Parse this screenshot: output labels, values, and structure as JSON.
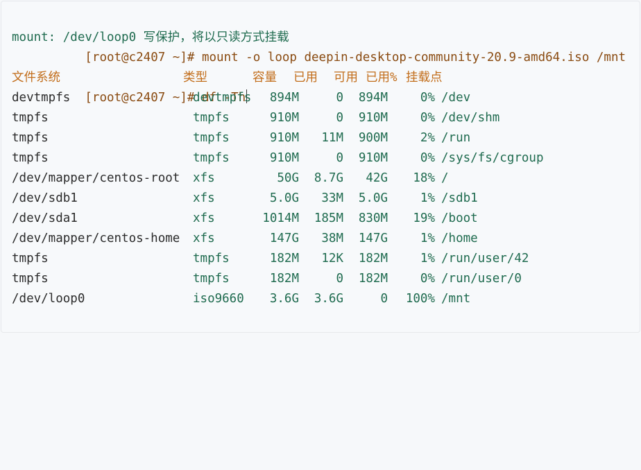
{
  "terminal": {
    "line1": {
      "prompt": "[root@c2407 ~]#",
      "command": " mount -o loop deepin-desktop-community-20.9-amd64.iso /mnt"
    },
    "line2": {
      "message": "mount: /dev/loop0 写保护，将以只读方式挂载"
    },
    "line3": {
      "prompt": "[root@c2407 ~]#",
      "command": " df -Th"
    },
    "header": {
      "filesystem": "文件系统",
      "type": "类型",
      "size": "容量",
      "used": "已用",
      "avail": "可用",
      "use_pct": "已用%",
      "mounted_on": "挂载点"
    },
    "rows": [
      {
        "filesystem": "devtmpfs",
        "type": "devtmpfs",
        "size": "894M",
        "used": "0",
        "avail": "894M",
        "use_pct": "0%",
        "mounted_on": "/dev"
      },
      {
        "filesystem": "tmpfs",
        "type": "tmpfs",
        "size": "910M",
        "used": "0",
        "avail": "910M",
        "use_pct": "0%",
        "mounted_on": "/dev/shm"
      },
      {
        "filesystem": "tmpfs",
        "type": "tmpfs",
        "size": "910M",
        "used": "11M",
        "avail": "900M",
        "use_pct": "2%",
        "mounted_on": "/run"
      },
      {
        "filesystem": "tmpfs",
        "type": "tmpfs",
        "size": "910M",
        "used": "0",
        "avail": "910M",
        "use_pct": "0%",
        "mounted_on": "/sys/fs/cgroup"
      },
      {
        "filesystem": "/dev/mapper/centos-root",
        "type": "xfs",
        "size": "50G",
        "used": "8.7G",
        "avail": "42G",
        "use_pct": "18%",
        "mounted_on": "/"
      },
      {
        "filesystem": "/dev/sdb1",
        "type": "xfs",
        "size": "5.0G",
        "used": "33M",
        "avail": "5.0G",
        "use_pct": "1%",
        "mounted_on": "/sdb1"
      },
      {
        "filesystem": "/dev/sda1",
        "type": "xfs",
        "size": "1014M",
        "used": "185M",
        "avail": "830M",
        "use_pct": "19%",
        "mounted_on": "/boot"
      },
      {
        "filesystem": "/dev/mapper/centos-home",
        "type": "xfs",
        "size": "147G",
        "used": "38M",
        "avail": "147G",
        "use_pct": "1%",
        "mounted_on": "/home"
      },
      {
        "filesystem": "tmpfs",
        "type": "tmpfs",
        "size": "182M",
        "used": "12K",
        "avail": "182M",
        "use_pct": "1%",
        "mounted_on": "/run/user/42"
      },
      {
        "filesystem": "tmpfs",
        "type": "tmpfs",
        "size": "182M",
        "used": "0",
        "avail": "182M",
        "use_pct": "0%",
        "mounted_on": "/run/user/0"
      },
      {
        "filesystem": "/dev/loop0",
        "type": "iso9660",
        "size": "3.6G",
        "used": "3.6G",
        "avail": "0",
        "use_pct": "100%",
        "mounted_on": "/mnt"
      }
    ]
  }
}
